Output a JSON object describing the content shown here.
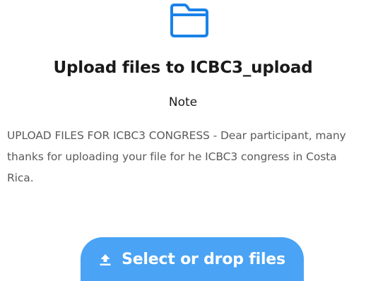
{
  "header": {
    "icon": "folder-icon",
    "title": "Upload files to ICBC3_upload"
  },
  "note": {
    "label": "Note",
    "text": "UPLOAD FILES FOR ICBC3 CONGRESS - Dear participant, many thanks for uploading your file for he ICBC3 congress in Costa Rica."
  },
  "upload": {
    "button_label": "Select or drop files",
    "icon": "upload-icon"
  },
  "colors": {
    "accent": "#4aa3f4",
    "icon_blue": "#1a82e8",
    "text_dark": "#1a1a1a",
    "text_muted": "#5b5b5b"
  }
}
